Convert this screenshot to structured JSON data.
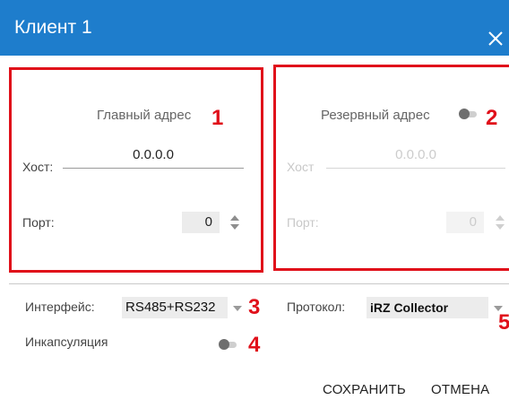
{
  "dialog": {
    "title": "Клиент 1",
    "close_icon": "close-icon",
    "accent_color": "#1e7dcc",
    "highlight_color": "#e0101a"
  },
  "primary": {
    "label": "Главный адрес",
    "marker": "1",
    "host_label": "Хост:",
    "host_value": "0.0.0.0",
    "port_label": "Порт:",
    "port_value": "0"
  },
  "reserve": {
    "label": "Резервный адрес",
    "marker": "2",
    "toggle_on": false,
    "host_label": "Хост",
    "host_value": "0.0.0.0",
    "port_label": "Порт:",
    "port_value": "0"
  },
  "settings": {
    "interface_label": "Интерфейс:",
    "interface_value": "RS485+RS232",
    "interface_marker": "3",
    "protocol_label": "Протокол:",
    "protocol_value": "iRZ Collector",
    "protocol_marker": "5",
    "encapsulation_label": "Инкапсуляция",
    "encapsulation_on": false,
    "encapsulation_marker": "4"
  },
  "actions": {
    "save_label": "СОХРАНИТЬ",
    "cancel_label": "ОТМЕНА"
  }
}
